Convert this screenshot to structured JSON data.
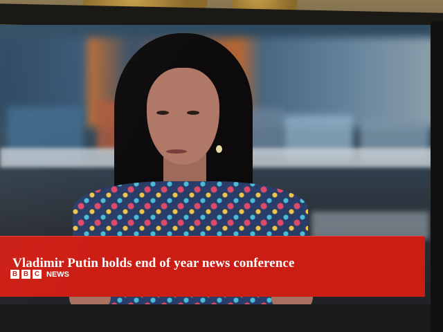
{
  "broadcast": {
    "headline": "Vladimir Putin holds end of year news conference",
    "brand_letters": [
      "B",
      "B",
      "C"
    ],
    "brand_word": "NEWS",
    "ticker_color": "#cc1d14"
  }
}
